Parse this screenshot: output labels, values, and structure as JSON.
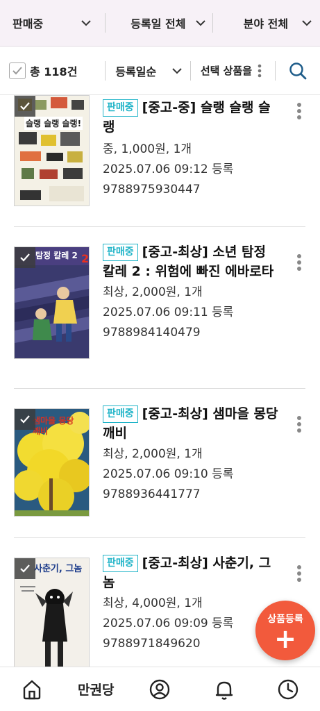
{
  "filters": {
    "status_label": "판매중",
    "date_label": "등록일 전체",
    "category_label": "분야 전체"
  },
  "toolbar": {
    "total_label": "총 118건",
    "sort_label": "등록일순",
    "select_action_label": "선택 상품을"
  },
  "items": [
    {
      "badge": "판매중",
      "title": "[중고-중] 슬랭 슬랭 슬랭",
      "detail": "중, 1,000원, 1개",
      "registered": "2025.07.06 09:12 등록",
      "isbn": "9788975930447",
      "cover_text": "슬랭 슬랭 슬랭!"
    },
    {
      "badge": "판매중",
      "title": "[중고-최상] 소년 탐정 칼레 2 : 위험에 빠진 에바로타",
      "detail": "최상, 2,000원, 1개",
      "registered": "2025.07.06 09:11 등록",
      "isbn": "9788984140479",
      "cover_text": "탐정 칼레 2"
    },
    {
      "badge": "판매중",
      "title": "[중고-최상] 샘마을 몽당깨비",
      "detail": "최상, 2,000원, 1개",
      "registered": "2025.07.06 09:10 등록",
      "isbn": "9788936441777",
      "cover_text": "샘마을 몽당깨비"
    },
    {
      "badge": "판매중",
      "title": "[중고-최상] 사춘기, 그놈",
      "detail": "최상, 4,000원, 1개",
      "registered": "2025.07.06 09:09 등록",
      "isbn": "9788971849620",
      "cover_text": "사춘기, 그놈"
    }
  ],
  "fab": {
    "label": "상품등록",
    "plus": "+"
  },
  "bottom_nav": {
    "store_label": "만권당"
  },
  "colors": {
    "accent": "#20b4c8",
    "fab": "#f25a3c",
    "filter_bg": "#f7f1f7"
  },
  "icons": [
    "chevron-down-icon",
    "check-icon",
    "more-vertical-icon",
    "search-icon",
    "home-icon",
    "user-icon",
    "bell-icon",
    "clock-icon"
  ]
}
